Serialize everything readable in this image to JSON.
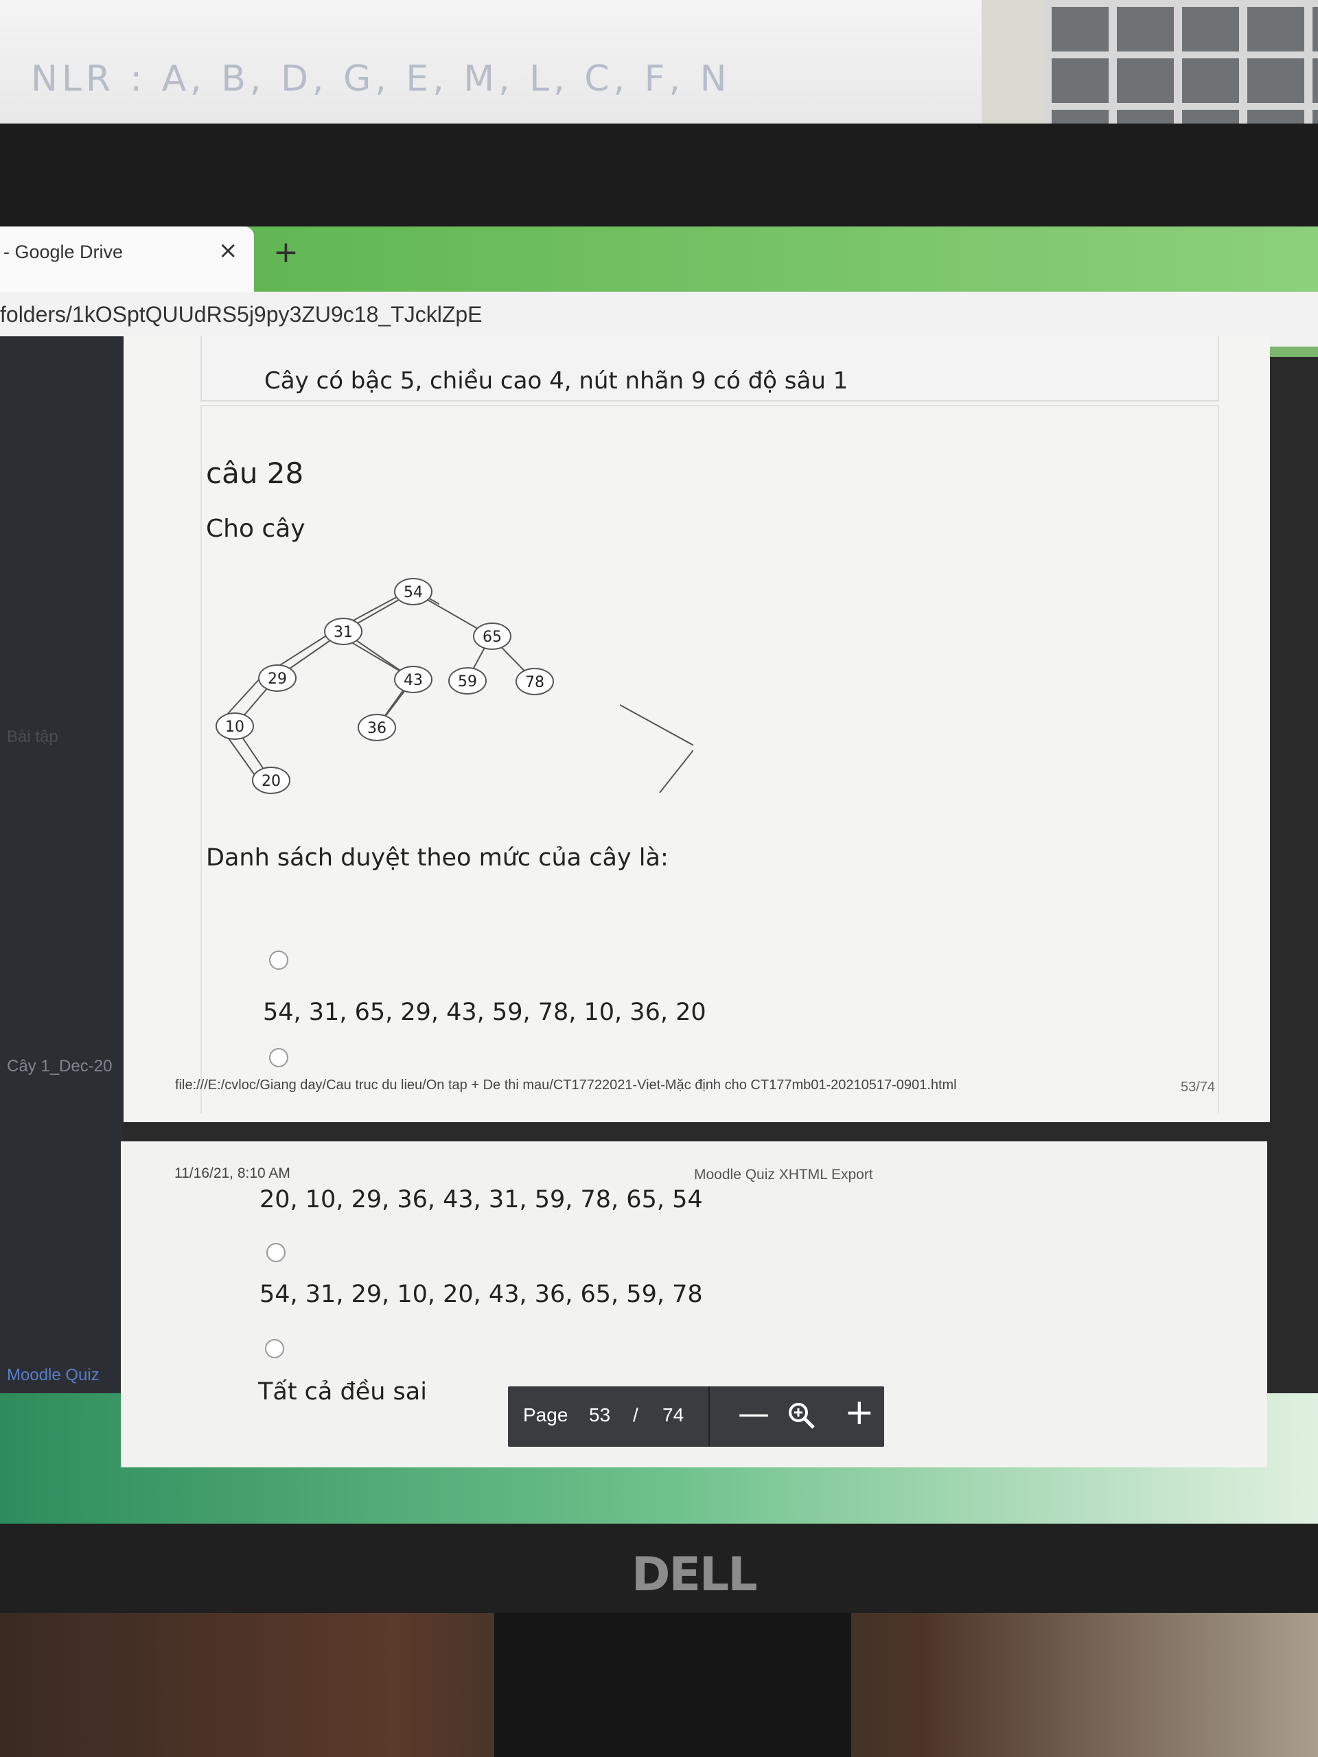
{
  "environment": {
    "whiteboard_text": "NLR : A, B, D, G, E, M, L, C, F, N",
    "monitor_brand": "DELL"
  },
  "browser": {
    "tab_title": "- Google Drive",
    "tab_close": "×",
    "new_tab": "+",
    "url": "folders/1kOSptQUUdRS5j9py3ZU9c18_TJcklZpE"
  },
  "drive_sidebar": {
    "items": [
      "Bài tập",
      "Cây 1_Dec-20",
      "Moodle Quiz"
    ]
  },
  "page1": {
    "previous_answer": "Cây có  bậc 5, chiều cao 4, nút nhãn 9 có độ sâu 1",
    "question_title": "câu 28",
    "question_intro": "Cho cây",
    "question_prompt": "Danh sách duyệt theo mức của cây là:",
    "options": [
      "54, 31, 65, 29, 43, 59, 78, 10, 36, 20"
    ],
    "footer_url": "file:///E:/cvloc/Giang day/Cau truc du lieu/On tap + De thi mau/CT17722021-Viet-Mặc định cho CT177mb01-20210517-0901.html",
    "footer_page": "53/74"
  },
  "tree": {
    "nodes": [
      "54",
      "31",
      "65",
      "29",
      "43",
      "59",
      "78",
      "10",
      "36",
      "20"
    ]
  },
  "page2": {
    "header_date": "11/16/21, 8:10 AM",
    "header_title": "Moodle Quiz XHTML Export",
    "options": [
      "20, 10, 29, 36, 43, 31, 59, 78, 65, 54",
      "54, 31, 29, 10, 20, 43, 36, 65, 59, 78",
      "Tất cả đều sai"
    ]
  },
  "pager": {
    "label": "Page",
    "current": "53",
    "separator": "/",
    "total": "74",
    "zoom_out": "—",
    "zoom_in": "+"
  }
}
